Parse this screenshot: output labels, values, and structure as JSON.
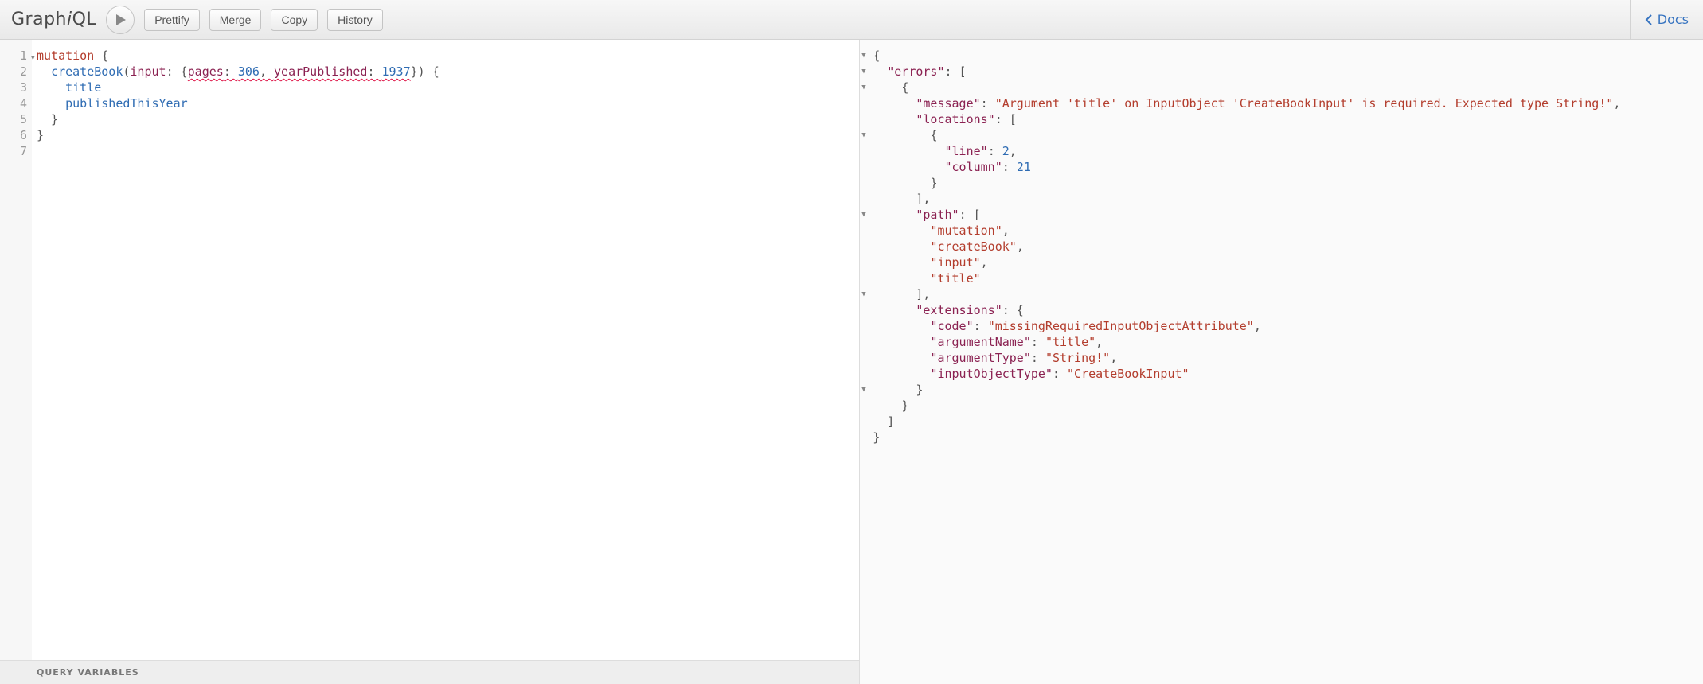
{
  "app": {
    "name": "GraphiQL"
  },
  "toolbar": {
    "run": "Run",
    "prettify": "Prettify",
    "merge": "Merge",
    "copy": "Copy",
    "history": "History",
    "docs": "Docs"
  },
  "editor": {
    "lineCount": 7,
    "foldableLines": [
      1
    ],
    "query_tokens": [
      [
        {
          "t": "mutation",
          "c": "kw"
        },
        {
          "t": " {",
          "c": "punct"
        }
      ],
      [
        {
          "t": "  ",
          "c": ""
        },
        {
          "t": "createBook",
          "c": "field"
        },
        {
          "t": "(",
          "c": "punct"
        },
        {
          "t": "input",
          "c": "arg"
        },
        {
          "t": ": {",
          "c": "punct"
        },
        {
          "t": "pages",
          "c": "arg squiggle"
        },
        {
          "t": ": ",
          "c": "punct squiggle"
        },
        {
          "t": "306",
          "c": "num squiggle"
        },
        {
          "t": ", ",
          "c": "punct squiggle"
        },
        {
          "t": "yearPublished",
          "c": "arg squiggle"
        },
        {
          "t": ": ",
          "c": "punct squiggle"
        },
        {
          "t": "1937",
          "c": "num squiggle"
        },
        {
          "t": "}) {",
          "c": "punct"
        }
      ],
      [
        {
          "t": "    ",
          "c": ""
        },
        {
          "t": "title",
          "c": "field"
        }
      ],
      [
        {
          "t": "    ",
          "c": ""
        },
        {
          "t": "publishedThisYear",
          "c": "field"
        }
      ],
      [
        {
          "t": "  }",
          "c": "punct"
        }
      ],
      [
        {
          "t": "}",
          "c": "punct"
        }
      ],
      []
    ]
  },
  "variables": {
    "label": "QUERY VARIABLES"
  },
  "result_foldable_lines": [
    1,
    2,
    3,
    6,
    11,
    16,
    22
  ],
  "result_tokens": [
    [
      {
        "t": "{",
        "c": "rp"
      }
    ],
    [
      {
        "t": "  ",
        "c": ""
      },
      {
        "t": "\"errors\"",
        "c": "rk"
      },
      {
        "t": ": [",
        "c": "rp"
      }
    ],
    [
      {
        "t": "    {",
        "c": "rp"
      }
    ],
    [
      {
        "t": "      ",
        "c": ""
      },
      {
        "t": "\"message\"",
        "c": "rk"
      },
      {
        "t": ": ",
        "c": "rp"
      },
      {
        "t": "\"Argument 'title' on InputObject 'CreateBookInput' is required. Expected type String!\"",
        "c": "rs"
      },
      {
        "t": ",",
        "c": "rp"
      }
    ],
    [
      {
        "t": "      ",
        "c": ""
      },
      {
        "t": "\"locations\"",
        "c": "rk"
      },
      {
        "t": ": [",
        "c": "rp"
      }
    ],
    [
      {
        "t": "        {",
        "c": "rp"
      }
    ],
    [
      {
        "t": "          ",
        "c": ""
      },
      {
        "t": "\"line\"",
        "c": "rk"
      },
      {
        "t": ": ",
        "c": "rp"
      },
      {
        "t": "2",
        "c": "rn"
      },
      {
        "t": ",",
        "c": "rp"
      }
    ],
    [
      {
        "t": "          ",
        "c": ""
      },
      {
        "t": "\"column\"",
        "c": "rk"
      },
      {
        "t": ": ",
        "c": "rp"
      },
      {
        "t": "21",
        "c": "rn"
      }
    ],
    [
      {
        "t": "        }",
        "c": "rp"
      }
    ],
    [
      {
        "t": "      ],",
        "c": "rp"
      }
    ],
    [
      {
        "t": "      ",
        "c": ""
      },
      {
        "t": "\"path\"",
        "c": "rk"
      },
      {
        "t": ": [",
        "c": "rp"
      }
    ],
    [
      {
        "t": "        ",
        "c": ""
      },
      {
        "t": "\"mutation\"",
        "c": "rs"
      },
      {
        "t": ",",
        "c": "rp"
      }
    ],
    [
      {
        "t": "        ",
        "c": ""
      },
      {
        "t": "\"createBook\"",
        "c": "rs"
      },
      {
        "t": ",",
        "c": "rp"
      }
    ],
    [
      {
        "t": "        ",
        "c": ""
      },
      {
        "t": "\"input\"",
        "c": "rs"
      },
      {
        "t": ",",
        "c": "rp"
      }
    ],
    [
      {
        "t": "        ",
        "c": ""
      },
      {
        "t": "\"title\"",
        "c": "rs"
      }
    ],
    [
      {
        "t": "      ],",
        "c": "rp"
      }
    ],
    [
      {
        "t": "      ",
        "c": ""
      },
      {
        "t": "\"extensions\"",
        "c": "rk"
      },
      {
        "t": ": {",
        "c": "rp"
      }
    ],
    [
      {
        "t": "        ",
        "c": ""
      },
      {
        "t": "\"code\"",
        "c": "rk"
      },
      {
        "t": ": ",
        "c": "rp"
      },
      {
        "t": "\"missingRequiredInputObjectAttribute\"",
        "c": "rs"
      },
      {
        "t": ",",
        "c": "rp"
      }
    ],
    [
      {
        "t": "        ",
        "c": ""
      },
      {
        "t": "\"argumentName\"",
        "c": "rk"
      },
      {
        "t": ": ",
        "c": "rp"
      },
      {
        "t": "\"title\"",
        "c": "rs"
      },
      {
        "t": ",",
        "c": "rp"
      }
    ],
    [
      {
        "t": "        ",
        "c": ""
      },
      {
        "t": "\"argumentType\"",
        "c": "rk"
      },
      {
        "t": ": ",
        "c": "rp"
      },
      {
        "t": "\"String!\"",
        "c": "rs"
      },
      {
        "t": ",",
        "c": "rp"
      }
    ],
    [
      {
        "t": "        ",
        "c": ""
      },
      {
        "t": "\"inputObjectType\"",
        "c": "rk"
      },
      {
        "t": ": ",
        "c": "rp"
      },
      {
        "t": "\"CreateBookInput\"",
        "c": "rs"
      }
    ],
    [
      {
        "t": "      }",
        "c": "rp"
      }
    ],
    [
      {
        "t": "    }",
        "c": "rp"
      }
    ],
    [
      {
        "t": "  ]",
        "c": "rp"
      }
    ],
    [
      {
        "t": "}",
        "c": "rp"
      }
    ]
  ]
}
